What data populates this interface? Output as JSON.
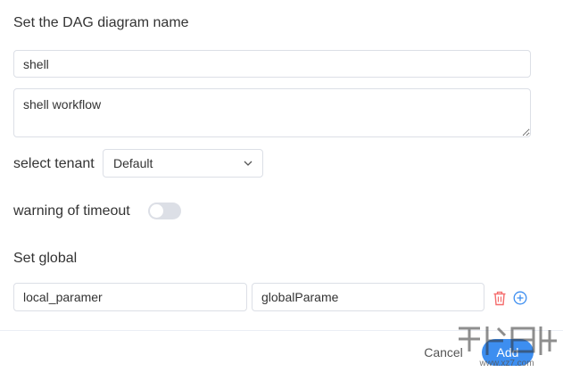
{
  "dag_name_section": {
    "heading": "Set the DAG diagram name",
    "name_value": "shell",
    "description_value": "shell workflow"
  },
  "tenant": {
    "label": "select tenant",
    "selected": "Default"
  },
  "timeout": {
    "label": "warning of timeout",
    "enabled": false
  },
  "global_params": {
    "heading": "Set global",
    "key_value": "local_paramer",
    "value_value": "globalParame"
  },
  "footer": {
    "cancel_label": "Cancel",
    "add_label": "Add"
  },
  "watermark": {
    "site": "www.xz7.com"
  },
  "colors": {
    "primary": "#3d8ef0",
    "delete": "#f56c6c",
    "toggle_off": "#dcdfe6"
  },
  "icons": {
    "delete": "trash-icon",
    "add": "plus-circle-icon",
    "dropdown": "chevron-down-icon"
  }
}
